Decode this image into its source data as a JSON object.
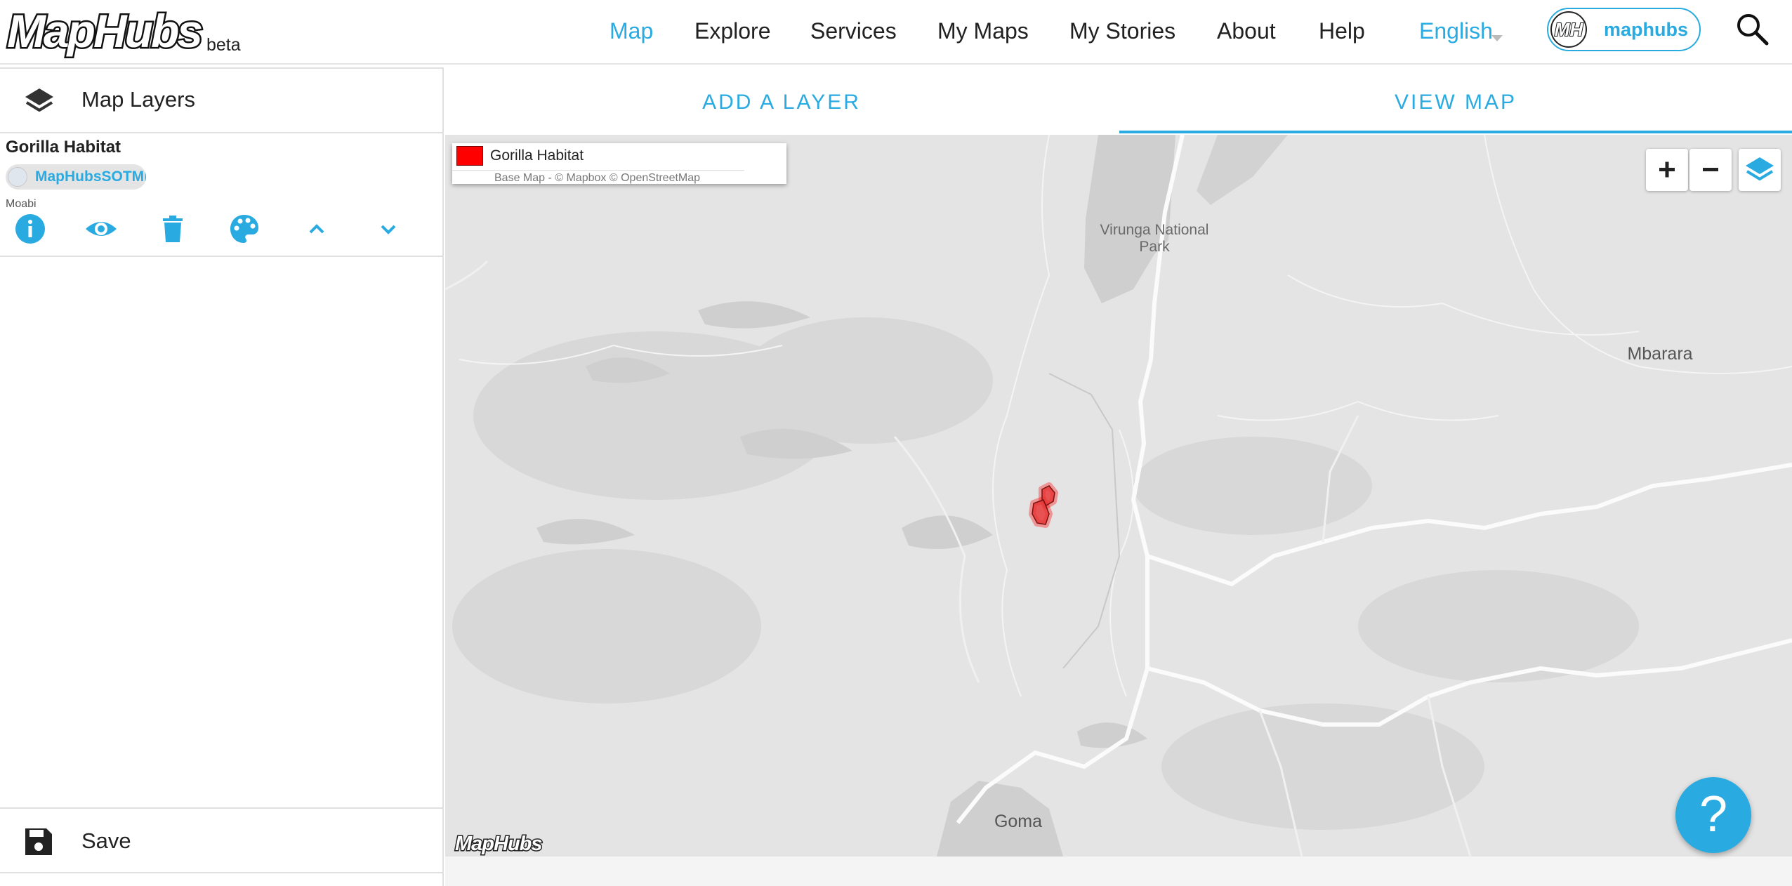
{
  "app": {
    "logo": "MapHubs",
    "badge": "beta"
  },
  "nav": {
    "items": [
      "Map",
      "Explore",
      "Services",
      "My Maps",
      "My Stories",
      "About",
      "Help"
    ],
    "active": "Map",
    "language": "English",
    "user": {
      "avatar_text": "MH",
      "name": "maphubs"
    },
    "search_icon": "search-icon"
  },
  "left_panel": {
    "title": "Map Layers",
    "layers": [
      {
        "name": "Gorilla Habitat",
        "source": "MapHubsSOTMI",
        "source_sub": "Moabi",
        "actions": [
          "info-icon",
          "visibility-icon",
          "delete-icon",
          "palette-icon",
          "move-up-icon",
          "move-down-icon"
        ]
      }
    ],
    "save_label": "Save"
  },
  "tabs": {
    "add_layer": "ADD A LAYER",
    "view_map": "VIEW MAP",
    "active": "view_map"
  },
  "map": {
    "legend": {
      "layer_name": "Gorilla Habitat",
      "layer_color": "#ff0000",
      "attribution": "Base Map - © Mapbox © OpenStreetMap"
    },
    "labels": {
      "park": "Virunga National Park",
      "city_1": "Mbarara",
      "city_2": "Goma"
    },
    "watermark": "MapHubs",
    "controls": [
      "zoom-in-icon",
      "zoom-out-icon",
      "layers-icon"
    ]
  },
  "help": {
    "label": "?"
  },
  "colors": {
    "accent": "#29abe2",
    "map_background": "#e3e3e3",
    "habitat_fill": "#ff0000"
  }
}
